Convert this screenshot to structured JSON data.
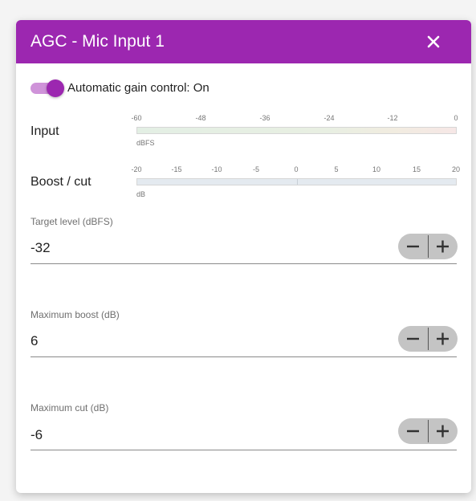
{
  "dialog": {
    "title": "AGC - Mic Input 1",
    "close_icon": "close-icon",
    "accent_color": "#9c27b0"
  },
  "agc_toggle": {
    "label": "Automatic gain control: On",
    "checked": true
  },
  "input_meter": {
    "label": "Input",
    "ticks": [
      "-60",
      "-48",
      "-36",
      "-24",
      "-12",
      "0"
    ],
    "unit": "dBFS"
  },
  "boost_meter": {
    "label": "Boost / cut",
    "ticks": [
      "-20",
      "-15",
      "-10",
      "-5",
      "0",
      "5",
      "10",
      "15",
      "20"
    ],
    "unit": "dB"
  },
  "fields": [
    {
      "label": "Target level (dBFS)",
      "value": "-32"
    },
    {
      "label": "Maximum boost (dB)",
      "value": "6"
    },
    {
      "label": "Maximum cut (dB)",
      "value": "-6"
    }
  ],
  "stepper_icons": {
    "decrement": "minus-icon",
    "increment": "plus-icon"
  }
}
